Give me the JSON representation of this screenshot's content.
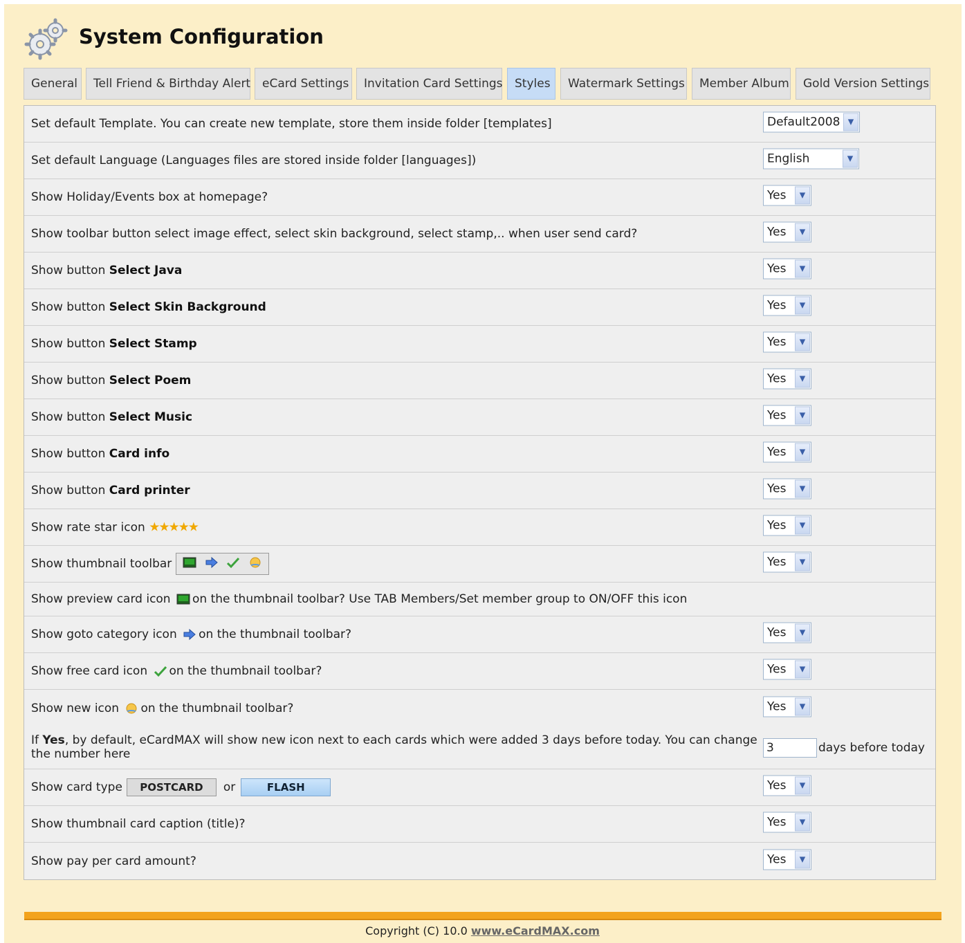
{
  "page": {
    "title": "System Configuration"
  },
  "tabs": [
    {
      "label": "General"
    },
    {
      "label": "Tell Friend & Birthday Alert"
    },
    {
      "label": "eCard Settings"
    },
    {
      "label": "Invitation Card Settings"
    },
    {
      "label": "Styles",
      "active": true
    },
    {
      "label": "Watermark Settings"
    },
    {
      "label": "Member Album"
    },
    {
      "label": "Gold Version Settings"
    }
  ],
  "settings": {
    "template": {
      "label": "Set default Template. You can create new template, store them inside folder [templates]",
      "value": "Default2008"
    },
    "language": {
      "label": "Set default Language (Languages files are stored inside folder [languages])",
      "value": "English"
    },
    "holiday_box": {
      "label": "Show Holiday/Events box at homepage?",
      "value": "Yes"
    },
    "toolbar_buttons": {
      "label": "Show toolbar button select image effect, select skin background, select stamp,.. when user send card?",
      "value": "Yes"
    },
    "select_java": {
      "prefix": "Show button ",
      "bold": "Select Java",
      "value": "Yes"
    },
    "select_skin": {
      "prefix": "Show button ",
      "bold": "Select Skin Background",
      "value": "Yes"
    },
    "select_stamp": {
      "prefix": "Show button ",
      "bold": "Select Stamp",
      "value": "Yes"
    },
    "select_poem": {
      "prefix": "Show button ",
      "bold": "Select Poem",
      "value": "Yes"
    },
    "select_music": {
      "prefix": "Show button ",
      "bold": "Select Music",
      "value": "Yes"
    },
    "card_info": {
      "prefix": "Show button ",
      "bold": "Card info",
      "value": "Yes"
    },
    "card_printer": {
      "prefix": "Show button ",
      "bold": "Card printer",
      "value": "Yes"
    },
    "rate_star": {
      "label": "Show rate star icon",
      "stars": "★★★★★",
      "value": "Yes"
    },
    "thumb_toolbar": {
      "label": "Show thumbnail toolbar",
      "value": "Yes"
    },
    "preview_icon": {
      "before": "Show preview card icon",
      "after": "on the thumbnail toolbar? Use TAB Members/Set member group to ON/OFF this icon"
    },
    "goto_category": {
      "before": "Show goto category icon",
      "after": "on the thumbnail toolbar?",
      "value": "Yes"
    },
    "free_card": {
      "before": "Show free card icon",
      "after": "on the thumbnail toolbar?",
      "value": "Yes"
    },
    "new_icon": {
      "before": "Show new icon",
      "after": "on the thumbnail toolbar?",
      "value": "Yes"
    },
    "new_days": {
      "line1_prefix": "If ",
      "line1_bold": "Yes",
      "line1_rest": ", by default, eCardMAX will show new icon next to each cards which were added 3 days before today. You can change",
      "line2": "the number here",
      "value": "3",
      "suffix": "days before today"
    },
    "card_type": {
      "label": "Show card type",
      "postcard": "POSTCARD",
      "or": "or",
      "flash": "FLASH",
      "value": "Yes"
    },
    "caption": {
      "label": "Show thumbnail card caption (title)?",
      "value": "Yes"
    },
    "pay_per_card": {
      "label": "Show pay per card amount?",
      "value": "Yes"
    }
  },
  "footer": {
    "copyright": "Copyright (C) 10.0",
    "link": "www.eCardMAX.com"
  },
  "colors": {
    "page_bg": "#fcefc8",
    "active_tab": "#c6dcf6",
    "footer_bar": "#f3a31d",
    "star": "#f0a800"
  }
}
